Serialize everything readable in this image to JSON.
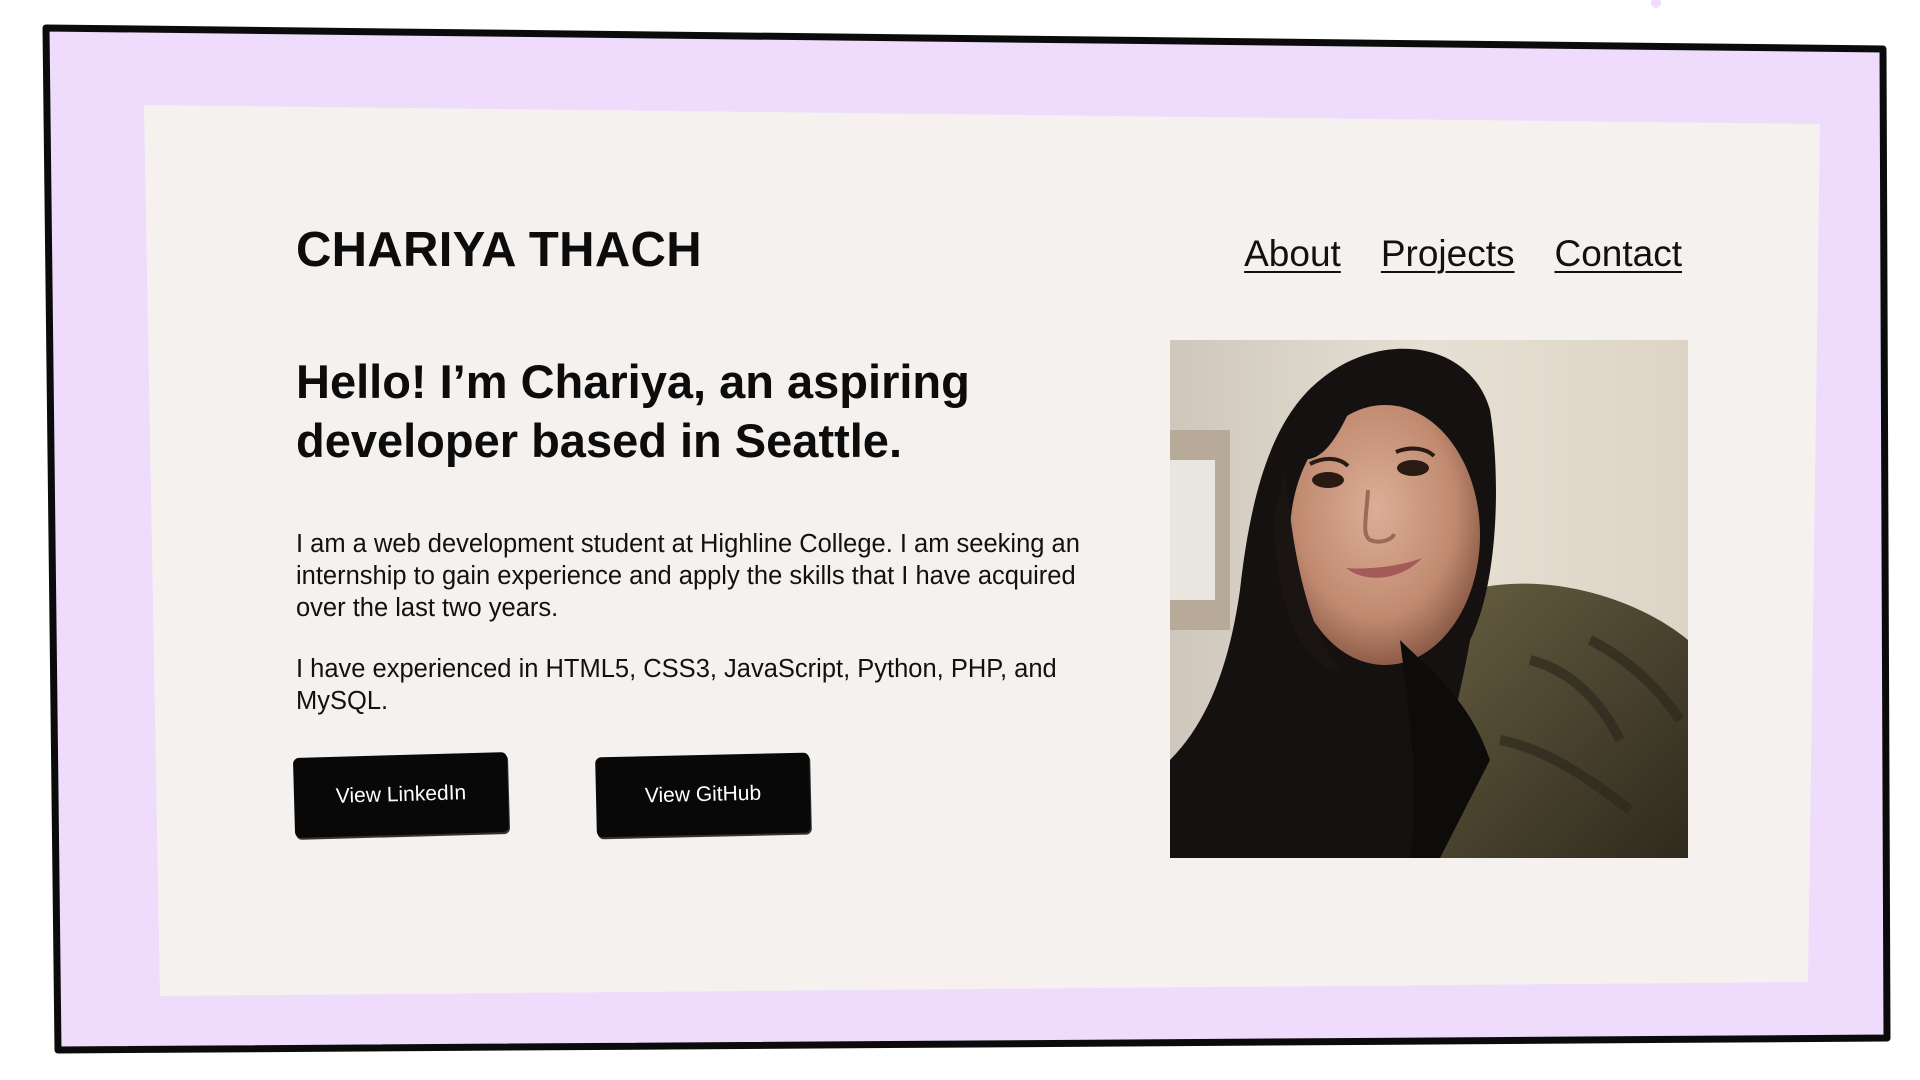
{
  "site": {
    "name": "CHARIYA THACH"
  },
  "nav": {
    "items": [
      {
        "label": "About"
      },
      {
        "label": "Projects"
      },
      {
        "label": "Contact"
      }
    ]
  },
  "hero": {
    "headline": "Hello! I’m Chariya, an aspiring developer based in Seattle.",
    "paragraph_1": "I am a web development student at Highline College.  I am seeking an internship to gain experience and apply the skills that I have acquired over the last two years.",
    "paragraph_2": "I have experienced in HTML5, CSS3, JavaScript, Python, PHP, and MySQL.",
    "buttons": {
      "linkedin": "View LinkedIn",
      "github": "View GitHub"
    }
  },
  "colors": {
    "outer_background": "#efdcfd",
    "card_background": "#f4f1ee",
    "frame_border": "#0b0b0b",
    "button_background": "#080808",
    "button_text": "#ffffff"
  }
}
